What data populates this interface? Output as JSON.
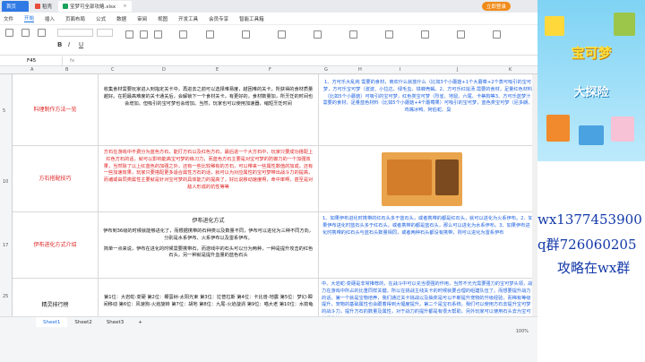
{
  "titlebar": {
    "tabs": [
      {
        "label": "首页"
      },
      {
        "label": "稻壳"
      },
      {
        "label": "宝梦可全部攻略.xlsx"
      }
    ],
    "login_label": "立即登录"
  },
  "menubar": {
    "items": [
      "文件",
      "开始",
      "插入",
      "页面布局",
      "公式",
      "数据",
      "审阅",
      "视图",
      "开发工具",
      "会员专享",
      "智能工具箱"
    ],
    "active_index": 1
  },
  "formula_bar": {
    "cell_ref": "F45",
    "fx": "fx"
  },
  "columns": [
    "A",
    "B",
    "C",
    "D",
    "E",
    "F",
    "G",
    "H",
    "I",
    "J",
    "K"
  ],
  "rows": [
    "5",
    "10",
    "17",
    "25"
  ],
  "sheet": {
    "row5": {
      "label": "料理制作方法一览",
      "main": "收集食材需要玩家进入到指定关卡中，再进去之前可以选择难易度，越困难的关卡，所获得的食材质量越好。在把最高难度的关卡通关后，会解锁下一个食材关卡，有更好的，食材数量加，所烹饪的时间也会增加。但吸引的宝可梦也会增加。当然，玩家也可以使用加速器，缩短烹饪时间",
      "right": "1、方可乐大乱炖 需要的食材，商欢什么就放什么（比如3个小蘑菇+1个大蘑菜+2个蒸可吸引的宝可梦，方可乐宝可梦（波波、小拉达、绿毛虫、铁蝉壳蝎。2、方可乐红烩汤 需要的食材，足量红色材料（比如5个小蘑菇）可吸引的宝可梦，红色类宝可梦（烈雀、地鼠、六尾、卡蒂狗等3、方可乐蓝梦汁 需要的食材，足量蓝色材料（比如5个小蘑菇+4个蘑莓果）可吸引的宝可梦，蓝色类宝可梦（尼多朗、鸡嘴冰鸭、阿伯蛇、臭"
    },
    "row10": {
      "label": "方石搭配技巧",
      "main": "方石在游戏中不费分为蓝色方石，能打方石以及红色方石，最后进一个大方石中，玩家只要成功搭配上红色方石的话，就可以影响能高宝可梦的练习力，而蓝色方石主要是对宝可梦的防御力的一个加强效果，当然除了以上红蓝色的加强之外，还有一些比较稀有的方石，可以带来一些属性数值的加成，还有一些加速效果，玩家只要搭配更多适合属性方石的话，就可以为对应属性的宝可梦带出战斗力的提高，而诸或由同类属性主要就是针对宝可梦的具体能力的提高了，好比说移动速度啊，命中率啊，甚至是对敌人形成的抗性等等"
    },
    "row17": {
      "label": "伊布进化方式介绍",
      "title": "伊布进化方式",
      "main": "伊布到36级的时候就能够进化了，而根据携带的石种类以及数量不同，伊布可以进化为三种不同方向，分别是水系伊布、火系伊布以及雷系伊布。",
      "main2": "简单一点来说，伊布在进化的时候需要携带石，而游戏中的石头可以分为两种，一种是提升攻击的红色石头，另一种就是提升血量的蓝色石头",
      "right": "1、如果伊布进化时携带的红石头多于蓝石头，或者携带的都是红石头，就可以进化为火系伊布。2、如果伊布进化时蓝石头多于红石头，或者携带的都是蓝石头，那么可以进化为水系伊布。3、如果伊布进化时携带的红石头与蓝石头数量相同，或者两种石头都没有携带，则可以进化为雷系伊布"
    },
    "row25": {
      "label": "精灵排行榜",
      "list": "第1位：大岩蛇-变硬 第2位：椰蛋树-太阳光束 第3位：拉普拉斯 第4位：卡比兽-地震 第5位：梦幻-瞬间移动 第6位：风速狗-火焰旋转 第7位：胡地 第8位：九尾-火焰漩涡 第9位：喵大老 第10位：水箭龟",
      "right": "中、大岩蛇-变硬是非常推荐的，在战斗中可以充当很强的作用，当然不光光需要强力的宝可梦头领，战力在游戏中所占的比重同样关键，所以在挑战主线关卡的时候就要合理的组建队伍了。而想要提升战力的话，第一个就是宝物培养，我们通过关卡挑战以及抽奖是可以不断提升宠物的升级经验，而稀有等级提升，宠物的基础属性也会跟着得到大幅度提升。第二个是宝石系统，我们可以使用方石去提升宝可梦的战斗力，提升方石的数量及属性，对于战力的提升都是有很大帮助，另外玩家可以使用石头去为宝可梦提升等级"
    }
  },
  "bottom": {
    "sheets": [
      "Sheet1",
      "Sheet2",
      "Sheet3"
    ],
    "active_sheet": 0,
    "zoom": "100%"
  },
  "side": {
    "promo_title": "宝可梦",
    "promo_sub": "大探险",
    "ad_lines": [
      "wx1377453900",
      "q群726060205",
      "攻略在wx群"
    ]
  }
}
